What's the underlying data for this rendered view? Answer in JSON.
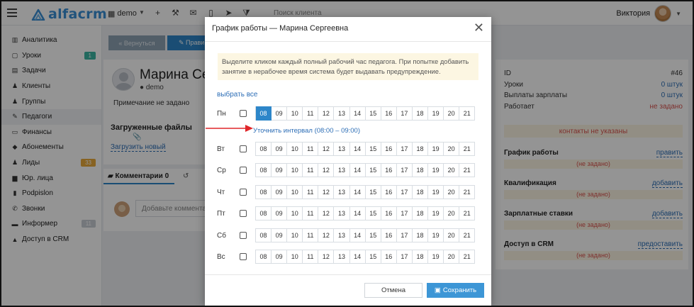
{
  "topbar": {
    "logo_text": "alfacrm",
    "branch": "demo",
    "search_placeholder": "Поиск клиента",
    "user_name": "Виктория",
    "icons": [
      "plus-icon",
      "wrench-icon",
      "mail-icon",
      "phone-icon",
      "send-icon",
      "filter-icon"
    ]
  },
  "sidebar": {
    "items": [
      {
        "label": "Аналитика",
        "icon": "chart-icon",
        "glyph": "▥"
      },
      {
        "label": "Уроки",
        "icon": "calendar-icon",
        "glyph": "▢",
        "badge": "1",
        "badge_color": "#3bb5a3"
      },
      {
        "label": "Задачи",
        "icon": "tasks-icon",
        "glyph": "▤"
      },
      {
        "label": "Клиенты",
        "icon": "user-icon",
        "glyph": "♟"
      },
      {
        "label": "Группы",
        "icon": "users-icon",
        "glyph": "♟"
      },
      {
        "label": "Педагоги",
        "icon": "teacher-icon",
        "glyph": "✎",
        "active": true
      },
      {
        "label": "Финансы",
        "icon": "money-icon",
        "glyph": "▭"
      },
      {
        "label": "Абонементы",
        "icon": "tag-icon",
        "glyph": "◆"
      },
      {
        "label": "Лиды",
        "icon": "leads-icon",
        "glyph": "♟",
        "badge": "33",
        "badge_color": "#e8a93a"
      },
      {
        "label": "Юр. лица",
        "icon": "briefcase-icon",
        "glyph": "▆"
      },
      {
        "label": "Podpislon",
        "icon": "document-icon",
        "glyph": "▮"
      },
      {
        "label": "Звонки",
        "icon": "phone-icon",
        "glyph": "✆"
      },
      {
        "label": "Информер",
        "icon": "informer-icon",
        "glyph": "▬",
        "badge": "11",
        "badge_color": "#c9ced4"
      },
      {
        "label": "Доступ в CRM",
        "icon": "lock-icon",
        "glyph": "▲"
      }
    ]
  },
  "page": {
    "back_label": "« Вернуться",
    "edit_label": "✎ Прави",
    "person_name": "Марина Сер",
    "person_branch": "demo",
    "note": "Примечание не задано",
    "files_title": "Загруженные файлы",
    "upload_link": "Загрузить новый",
    "comments_tab": "Комментарии 0",
    "comment_placeholder": "Добавьте комментарий"
  },
  "info_card": {
    "rows": [
      {
        "key": "ID",
        "value": "#46"
      },
      {
        "key": "Уроки",
        "value": "0 штук"
      },
      {
        "key": "Выплаты зарплаты",
        "value": "0 штук"
      },
      {
        "key": "Работает",
        "value": "не задано"
      }
    ],
    "contacts_warning": "контакты не указаны",
    "sections": [
      {
        "title": "График работы",
        "action": "править",
        "empty": "(не задано)"
      },
      {
        "title": "Квалификация",
        "action": "добавить",
        "empty": "(не задано)"
      },
      {
        "title": "Зарплатные ставки",
        "action": "добавить",
        "empty": "(не задано)"
      },
      {
        "title": "Доступ в CRM",
        "action": "предоставить",
        "empty": "(не задано)"
      }
    ]
  },
  "modal": {
    "title": "График работы — Марина Сергеевна",
    "info_text": "Выделите кликом каждый полный рабочий час педагога. При попытке добавить занятие в нерабочее время система будет выдавать предупреждение.",
    "select_all": "выбрать все",
    "interval_link": "Уточнить интервал (08:00 – 09:00)",
    "hours": [
      "08",
      "09",
      "10",
      "11",
      "12",
      "13",
      "14",
      "15",
      "16",
      "17",
      "18",
      "19",
      "20",
      "21"
    ],
    "days": [
      {
        "label": "Пн",
        "selected": [
          "08"
        ]
      },
      {
        "label": "Вт",
        "selected": []
      },
      {
        "label": "Ср",
        "selected": []
      },
      {
        "label": "Чт",
        "selected": []
      },
      {
        "label": "Пт",
        "selected": []
      },
      {
        "label": "Сб",
        "selected": []
      },
      {
        "label": "Вс",
        "selected": []
      }
    ],
    "cancel_label": "Отмена",
    "save_label": "Сохранить"
  },
  "colors": {
    "accent": "#2d86c9",
    "save_button": "#3d96d6",
    "warning_bg": "#fcf6e2",
    "error_text": "#d9534f",
    "annotation_arrow": "#e0262a"
  }
}
